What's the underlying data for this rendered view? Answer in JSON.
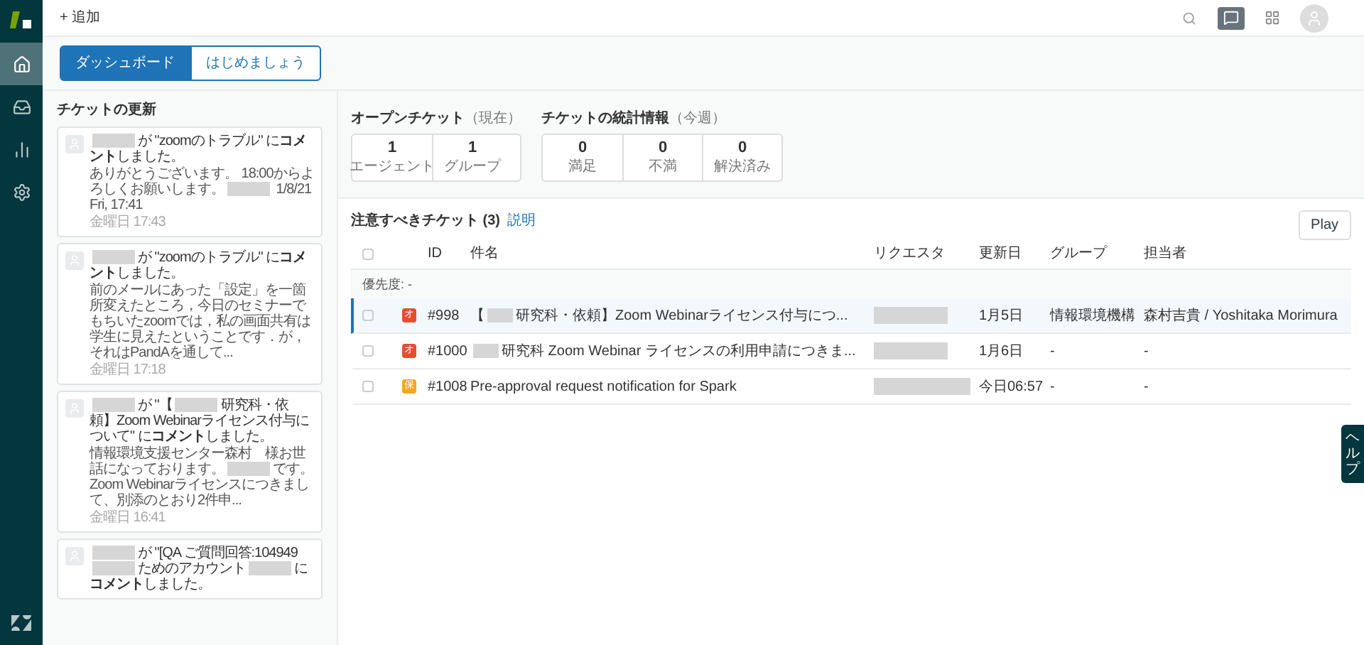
{
  "topbar": {
    "add_label": "+ 追加"
  },
  "nav": {
    "items": [
      {
        "kind": "home",
        "selected": true
      },
      {
        "kind": "views",
        "selected": false
      },
      {
        "kind": "reports",
        "selected": false
      },
      {
        "kind": "settings",
        "selected": false
      }
    ]
  },
  "tabs": [
    {
      "label": "ダッシュボード",
      "selected": true
    },
    {
      "label": "はじめましょう",
      "selected": false
    }
  ],
  "updates": {
    "title": "チケットの更新",
    "items": [
      {
        "title": [
          {
            "kind": "redacted"
          },
          {
            "kind": "text",
            "text": "が \"zoomのトラブル\" に**コメント**しました。"
          }
        ],
        "body": [
          {
            "kind": "text",
            "text": "ありがとうございます。 18:00からよろしくお願いします。"
          },
          {
            "kind": "redacted"
          },
          {
            "kind": "text",
            "text": " 1/8/21 Fri, 17:41"
          }
        ],
        "time": "金曜日 17:43"
      },
      {
        "title": [
          {
            "kind": "redacted"
          },
          {
            "kind": "text",
            "text": "が \"zoomのトラブル\" に**コメント**しました。"
          }
        ],
        "body": [
          {
            "kind": "text",
            "text": "前のメールにあった「設定」を一箇所変えたところ，今日のセミナーでもちいたzoomでは，私の画面共有は学生に見えたということです．が，それはPandAを通して..."
          }
        ],
        "time": "金曜日 17:18"
      },
      {
        "title": [
          {
            "kind": "redacted"
          },
          {
            "kind": "text",
            "text": "が \"【"
          },
          {
            "kind": "redacted"
          },
          {
            "kind": "text",
            "text": "研究科・依頼】Zoom Webinarライセンス付与について\" に**コメント**しました。"
          }
        ],
        "body": [
          {
            "kind": "text",
            "text": "情報環境支援センター森村　様お世話になっております。"
          },
          {
            "kind": "redacted"
          },
          {
            "kind": "text",
            "text": "です。 Zoom Webinarライセンスにつきまして、別添のとおり2件申..."
          }
        ],
        "time": "金曜日 16:41"
      },
      {
        "title": [
          {
            "kind": "redacted"
          },
          {
            "kind": "text",
            "text": "が \"[QA ご質問回答:104949"
          },
          {
            "kind": "redacted"
          },
          {
            "kind": "text",
            "text": "ためのアカウント"
          },
          {
            "kind": "redacted"
          },
          {
            "kind": "text",
            "text": "に**コメント**しました。"
          }
        ]
      }
    ]
  },
  "open_tickets": {
    "title": "オープンチケット",
    "note": "（現在）",
    "cells": [
      {
        "value": "1",
        "label": "エージェント"
      },
      {
        "value": "1",
        "label": "グループ"
      }
    ]
  },
  "ticket_stats": {
    "title": "チケットの統計情報",
    "note": "（今週）",
    "cells": [
      {
        "value": "0",
        "label": "満足"
      },
      {
        "value": "0",
        "label": "不満"
      },
      {
        "value": "0",
        "label": "解決済み"
      }
    ]
  },
  "tickets": {
    "title": "注意すべきチケット (3)",
    "help_link": "説明",
    "play_button": "Play",
    "select_all_checked": false,
    "columns": [
      "ID",
      "件名",
      "リクエスタ",
      "更新日",
      "グループ",
      "担当者"
    ],
    "group_label": "優先度: -",
    "rows": [
      {
        "selected": true,
        "checked": false,
        "status": "オ",
        "color": "#e34f32",
        "id": "#998",
        "subject": [
          {
            "kind": "text",
            "text": "【"
          },
          {
            "kind": "redacted"
          },
          {
            "kind": "text",
            "text": "研究科・依頼】Zoom Webinarライセンス付与につ..."
          }
        ],
        "updated": "1月5日",
        "group": "情報環境機構",
        "assignee": "森村吉貴 / Yoshitaka Morimura"
      },
      {
        "selected": false,
        "checked": false,
        "status": "オ",
        "color": "#e34f32",
        "id": "#1000",
        "subject": [
          {
            "kind": "redacted"
          },
          {
            "kind": "text",
            "text": "研究科 Zoom Webinar ライセンスの利用申請につきま..."
          }
        ],
        "updated": "1月6日",
        "group": "-",
        "assignee": "-"
      },
      {
        "selected": false,
        "checked": false,
        "status": "保",
        "color": "#f5a623",
        "id": "#1008",
        "subject": [
          {
            "kind": "text",
            "text": "Pre-approval request notification for Spark"
          }
        ],
        "updated": "今日06:57",
        "group": "-",
        "assignee": "-"
      }
    ]
  },
  "help_tab": "ヘルプ"
}
